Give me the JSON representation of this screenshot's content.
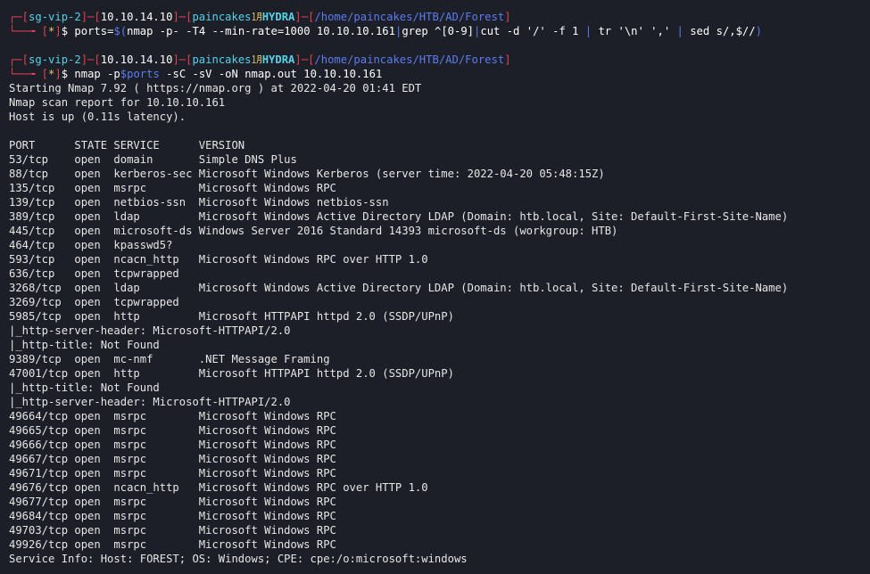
{
  "prompts": [
    {
      "host": "sg-vip-2",
      "ip": "10.10.14.10",
      "user": "paincakes",
      "sym": "㋀",
      "machine": "HYDRA",
      "path": "/home/paincakes/HTB/AD/Forest",
      "marker": "*",
      "cmd_parts": [
        {
          "t": "ports=",
          "c": "white"
        },
        {
          "t": "$(",
          "c": "blue"
        },
        {
          "t": "nmap -p- -T4 --min-rate=1000 10.10.10.161",
          "c": "white"
        },
        {
          "t": "|",
          "c": "blue"
        },
        {
          "t": "grep ^[0-9]",
          "c": "white"
        },
        {
          "t": "|",
          "c": "blue"
        },
        {
          "t": "cut -d '/' -f 1 ",
          "c": "white"
        },
        {
          "t": "| ",
          "c": "blue"
        },
        {
          "t": "tr '\\n' ',' ",
          "c": "white"
        },
        {
          "t": "| ",
          "c": "blue"
        },
        {
          "t": "sed s/,$//",
          "c": "white"
        },
        {
          "t": ")",
          "c": "blue"
        }
      ]
    },
    {
      "host": "sg-vip-2",
      "ip": "10.10.14.10",
      "user": "paincakes",
      "sym": "㋀",
      "machine": "HYDRA",
      "path": "/home/paincakes/HTB/AD/Forest",
      "marker": "*",
      "cmd_parts": [
        {
          "t": "nmap -p",
          "c": "white"
        },
        {
          "t": "$ports",
          "c": "blue"
        },
        {
          "t": " -sC -sV -oN nmap.out 10.10.10.161",
          "c": "white"
        }
      ]
    }
  ],
  "output_lines": [
    "Starting Nmap 7.92 ( https://nmap.org ) at 2022-04-20 01:41 EDT",
    "Nmap scan report for 10.10.10.161",
    "Host is up (0.11s latency).",
    "",
    "PORT      STATE SERVICE      VERSION",
    "53/tcp    open  domain       Simple DNS Plus",
    "88/tcp    open  kerberos-sec Microsoft Windows Kerberos (server time: 2022-04-20 05:48:15Z)",
    "135/tcp   open  msrpc        Microsoft Windows RPC",
    "139/tcp   open  netbios-ssn  Microsoft Windows netbios-ssn",
    "389/tcp   open  ldap         Microsoft Windows Active Directory LDAP (Domain: htb.local, Site: Default-First-Site-Name)",
    "445/tcp   open  microsoft-ds Windows Server 2016 Standard 14393 microsoft-ds (workgroup: HTB)",
    "464/tcp   open  kpasswd5?",
    "593/tcp   open  ncacn_http   Microsoft Windows RPC over HTTP 1.0",
    "636/tcp   open  tcpwrapped",
    "3268/tcp  open  ldap         Microsoft Windows Active Directory LDAP (Domain: htb.local, Site: Default-First-Site-Name)",
    "3269/tcp  open  tcpwrapped",
    "5985/tcp  open  http         Microsoft HTTPAPI httpd 2.0 (SSDP/UPnP)",
    "|_http-server-header: Microsoft-HTTPAPI/2.0",
    "|_http-title: Not Found",
    "9389/tcp  open  mc-nmf       .NET Message Framing",
    "47001/tcp open  http         Microsoft HTTPAPI httpd 2.0 (SSDP/UPnP)",
    "|_http-title: Not Found",
    "|_http-server-header: Microsoft-HTTPAPI/2.0",
    "49664/tcp open  msrpc        Microsoft Windows RPC",
    "49665/tcp open  msrpc        Microsoft Windows RPC",
    "49666/tcp open  msrpc        Microsoft Windows RPC",
    "49667/tcp open  msrpc        Microsoft Windows RPC",
    "49671/tcp open  msrpc        Microsoft Windows RPC",
    "49676/tcp open  ncacn_http   Microsoft Windows RPC over HTTP 1.0",
    "49677/tcp open  msrpc        Microsoft Windows RPC",
    "49684/tcp open  msrpc        Microsoft Windows RPC",
    "49703/tcp open  msrpc        Microsoft Windows RPC",
    "49926/tcp open  msrpc        Microsoft Windows RPC",
    "Service Info: Host: FOREST; OS: Windows; CPE: cpe:/o:microsoft:windows"
  ],
  "colors": {
    "background": "#1c1f27",
    "bracket": "#e2414c",
    "highlight": "#57d1ea",
    "operator": "#5c7cf0",
    "marker": "#e6c86a",
    "text": "#e6e6e6"
  }
}
